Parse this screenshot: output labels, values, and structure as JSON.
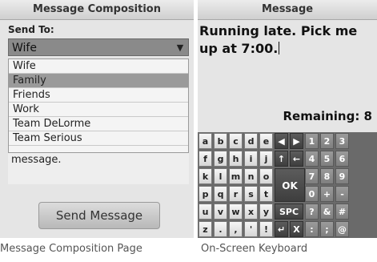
{
  "composition": {
    "title": "Message Composition",
    "send_to_label": "Send To:",
    "selected_recipient": "Wife",
    "dropdown_options": [
      "Wife",
      "Family",
      "Friends",
      "Work",
      "Team DeLorme",
      "Team Serious"
    ],
    "highlighted_option": "Family",
    "message_partial": "message.",
    "send_button_label": "Send Message",
    "caption": "Message Composition Page"
  },
  "keyboard_screen": {
    "title": "Message",
    "message_text": "Running late. Pick me\nup at 7:00.",
    "remaining_label": "Remaining: 8",
    "caption": "On-Screen Keyboard",
    "letter_rows": [
      [
        "a",
        "b",
        "c",
        "d",
        "e"
      ],
      [
        "f",
        "g",
        "h",
        "i",
        "j"
      ],
      [
        "k",
        "l",
        "m",
        "n",
        "o"
      ],
      [
        "p",
        "q",
        "r",
        "s",
        "t"
      ],
      [
        "u",
        "v",
        "w",
        "x",
        "y"
      ],
      [
        "z",
        ".",
        ",",
        "'",
        "!"
      ]
    ],
    "control_keys": {
      "left_arrow": "◀",
      "right_arrow": "▶",
      "shift": "↑",
      "backspace": "←",
      "ok": "OK",
      "space": "SPC",
      "enter": "↵",
      "clear": "X"
    },
    "number_rows": [
      [
        "1",
        "2",
        "3"
      ],
      [
        "4",
        "5",
        "6"
      ],
      [
        "7",
        "8",
        "9"
      ],
      [
        "0",
        "+",
        "-"
      ],
      [
        "?",
        "&",
        "#"
      ],
      [
        ":",
        ";",
        "@"
      ]
    ]
  }
}
